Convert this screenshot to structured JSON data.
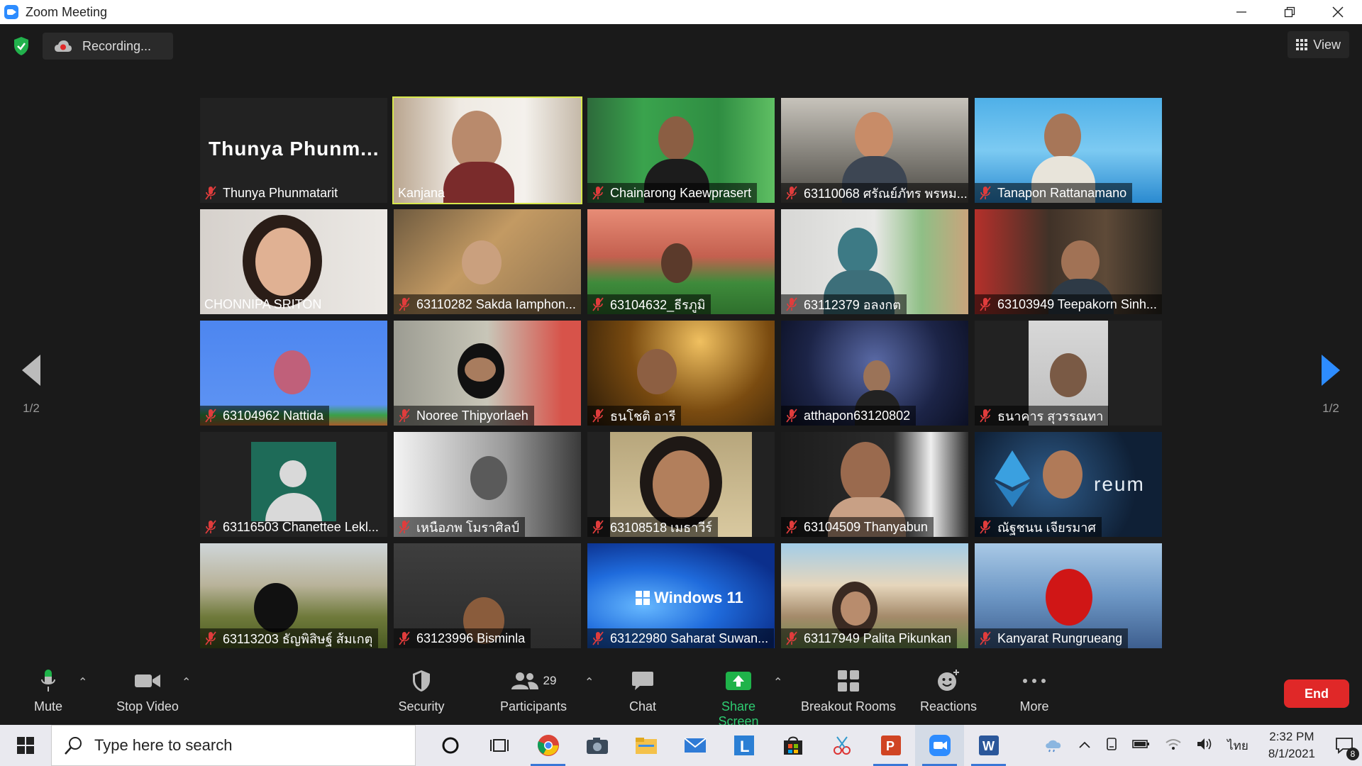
{
  "window": {
    "title": "Zoom Meeting"
  },
  "topbar": {
    "recording_label": "Recording...",
    "view_label": "View"
  },
  "gallery": {
    "page_indicator_left": "1/2",
    "page_indicator_right": "1/2",
    "tiles": [
      {
        "name": "Thunya Phunmatarit",
        "big_name": "Thunya  Phunm...",
        "muted": true
      },
      {
        "name": "Kanjana",
        "muted": false,
        "active": true
      },
      {
        "name": "Chainarong Kaewprasert",
        "muted": true
      },
      {
        "name": "63110068 ศรัณย์ภัทร พรหม...",
        "muted": true
      },
      {
        "name": "Tanapon Rattanamano",
        "muted": true
      },
      {
        "name": "CHONNIPA SRITON",
        "muted": false
      },
      {
        "name": "63110282 Sakda Iamphon...",
        "muted": true
      },
      {
        "name": "63104632_ธีรภูมิ",
        "muted": true
      },
      {
        "name": "63112379 อลงกต",
        "muted": true
      },
      {
        "name": "63103949 Teepakorn Sinh...",
        "muted": true
      },
      {
        "name": "63104962 Nattida",
        "muted": true
      },
      {
        "name": "Nooree Thipyorlaeh",
        "muted": true
      },
      {
        "name": "ธนโชติ อารี",
        "muted": true
      },
      {
        "name": "atthapon63120802",
        "muted": true
      },
      {
        "name": "ธนาคาร สุวรรณทา",
        "muted": true
      },
      {
        "name": "63116503 Chanettee Lekl...",
        "muted": true
      },
      {
        "name": "เหนือภพ โมราศิลป์",
        "muted": true
      },
      {
        "name": "63108518 เมธาวีร์",
        "muted": true
      },
      {
        "name": "63104509 Thanyabun",
        "muted": true
      },
      {
        "name": "ณัฐชนน เจียรมาศ",
        "muted": true
      },
      {
        "name": "63113203 ธัญพิสิษฐ์ ส้มเกตุ",
        "muted": true
      },
      {
        "name": "63123996 Bisminla",
        "muted": true
      },
      {
        "name": "63122980 Saharat Suwan...",
        "muted": true
      },
      {
        "name": "63117949 Palita Pikunkan",
        "muted": true
      },
      {
        "name": "Kanyarat Rungrueang",
        "muted": true
      }
    ],
    "overlay_text": {
      "windows11": "Windows 11",
      "ethereum": "reum"
    }
  },
  "toolbar": {
    "mute": "Mute",
    "stop_video": "Stop Video",
    "security": "Security",
    "participants": "Participants",
    "participants_count": "29",
    "chat": "Chat",
    "share_screen": "Share Screen",
    "breakout_rooms": "Breakout Rooms",
    "reactions": "Reactions",
    "more": "More",
    "end": "End"
  },
  "taskbar": {
    "search_placeholder": "Type here to search",
    "language": "ไทย",
    "time": "2:32 PM",
    "date": "8/1/2021",
    "notification_count": "8"
  },
  "colors": {
    "active_speaker": "#d8e84c",
    "share_green": "#2ecc71",
    "end_red": "#e02828",
    "zoom_blue": "#2d8cff"
  }
}
